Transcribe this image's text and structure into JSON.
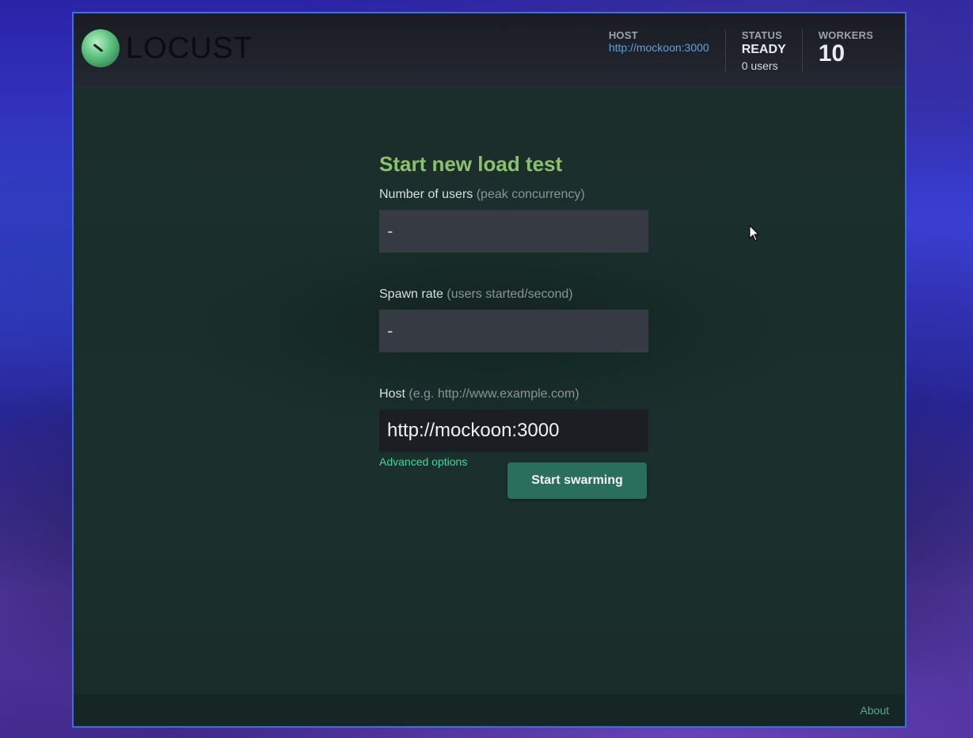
{
  "header": {
    "logo_text": "LOCUST",
    "host": {
      "title": "HOST",
      "value": "http://mockoon:3000"
    },
    "status": {
      "title": "STATUS",
      "value": "READY",
      "users": "0 users"
    },
    "workers": {
      "title": "WORKERS",
      "value": "10"
    }
  },
  "form": {
    "title": "Start new load test",
    "users": {
      "label": "Number of users",
      "hint": "(peak concurrency)",
      "value": "-"
    },
    "spawn": {
      "label": "Spawn rate",
      "hint": "(users started/second)",
      "value": "-"
    },
    "host": {
      "label": "Host",
      "hint": "(e.g. http://www.example.com)",
      "value": "http://mockoon:3000"
    },
    "advanced_link": "Advanced options",
    "submit_label": "Start swarming"
  },
  "footer": {
    "about": "About"
  },
  "colors": {
    "accent_green": "#8bc16a",
    "button": "#2a6e5e",
    "link": "#5aa3d8"
  }
}
